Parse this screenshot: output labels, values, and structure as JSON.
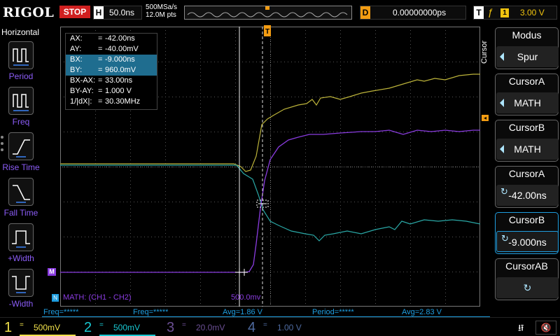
{
  "top": {
    "brand": "RIGOL",
    "run_state": "STOP",
    "h_letter": "H",
    "timebase": "50.0ns",
    "sample_rate": "500MSa/s",
    "mem_depth": "12.0M pts",
    "d_letter": "D",
    "delay": "0.00000000ps",
    "t_letter": "T",
    "trig_edge": "ƒ",
    "trig_source": "1",
    "trig_level": "3.00 V"
  },
  "left": {
    "title": "Horizontal",
    "items": [
      {
        "label": "Period"
      },
      {
        "label": "Freq"
      },
      {
        "label": "Rise Time"
      },
      {
        "label": "Fall Time"
      },
      {
        "label": "+Width"
      },
      {
        "label": "-Width"
      }
    ]
  },
  "cursor_panel": {
    "rows": [
      {
        "k": "AX:",
        "v": "-42.00ns"
      },
      {
        "k": "AY:",
        "v": "-40.00mV"
      },
      {
        "k": "BX:",
        "v": "-9.000ns"
      },
      {
        "k": "BY:",
        "v": "960.0mV"
      },
      {
        "k": "BX-AX:",
        "v": "33.00ns"
      },
      {
        "k": "BY-AY:",
        "v": "1.000 V"
      },
      {
        "k": "1/|dX|:",
        "v": "30.30MHz"
      }
    ],
    "eq": "="
  },
  "grid": {
    "trigger_marker": "T",
    "math_marker": "M",
    "math_label": "MATH: (CH1 - CH2)",
    "math_scale": "500.0mv",
    "math_marker_small": "N"
  },
  "right": {
    "vertical_label": "Cursor",
    "boxes": [
      {
        "title": "Modus",
        "value": "Spur"
      },
      {
        "title": "CursorA",
        "value": "MATH"
      },
      {
        "title": "CursorB",
        "value": "MATH"
      },
      {
        "title": "CursorA",
        "value": "-42.00ns"
      },
      {
        "title": "CursorB",
        "value": "-9.000ns"
      },
      {
        "title": "CursorAB",
        "value": ""
      }
    ]
  },
  "stats": [
    {
      "text": "Freq=*****"
    },
    {
      "text": "Freq=*****"
    },
    {
      "text": "Avg=1.86 V"
    },
    {
      "text": "Period=*****"
    },
    {
      "text": "Avg=2.83 V"
    }
  ],
  "channels": [
    {
      "num": "1",
      "coupling": "=",
      "value": "500mV",
      "color": "#f1e14b"
    },
    {
      "num": "2",
      "coupling": "=",
      "value": "500mV",
      "color": "#19c8d2"
    },
    {
      "num": "3",
      "coupling": "=",
      "value": "20.0mV",
      "color": "#8a5fc7"
    },
    {
      "num": "4",
      "coupling": "=",
      "value": "1.00 V",
      "color": "#6a8fd8"
    }
  ],
  "colors": {
    "ch1": "#bcb33a",
    "ch2": "#2aa8a6",
    "math": "#8a3ce0",
    "accent": "#1f9ee0",
    "trigger": "#f39c12"
  }
}
